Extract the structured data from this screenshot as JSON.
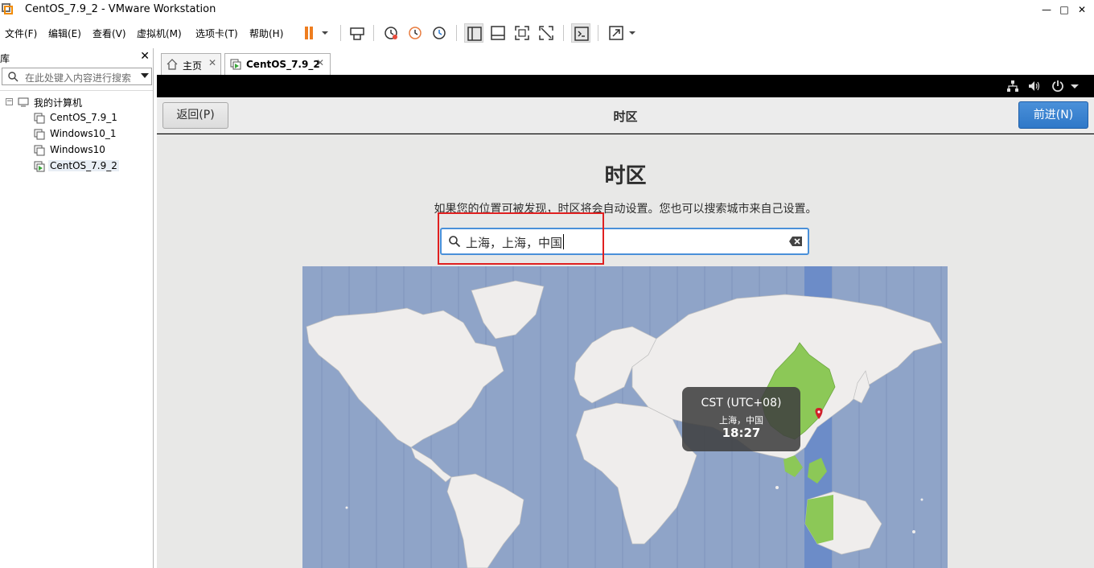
{
  "window": {
    "title": "CentOS_7.9_2 - VMware Workstation",
    "minimize": "—",
    "maximize": "□",
    "close": "✕"
  },
  "menu": [
    "文件(F)",
    "编辑(E)",
    "查看(V)",
    "虚拟机(M)",
    "选项卡(T)",
    "帮助(H)"
  ],
  "toolbar_icons": [
    "pause-icon",
    "send-ctrl-alt-del-icon",
    "snapshot-take-icon",
    "snapshot-revert-icon",
    "snapshot-manager-icon",
    "show-library-icon",
    "show-thumbnail-icon",
    "fullscreen-icon",
    "unity-icon",
    "console-view-icon",
    "stretch-icon"
  ],
  "library": {
    "title": "库",
    "close": "✕",
    "search_placeholder": "在此处键入内容进行搜索",
    "root": "我的计算机",
    "items": [
      "CentOS_7.9_1",
      "Windows10_1",
      "Windows10",
      "CentOS_7.9_2"
    ],
    "selected": "CentOS_7.9_2"
  },
  "tabs": [
    {
      "label": "主页",
      "close": "✕"
    },
    {
      "label": "CentOS_7.9_2",
      "close": "✕"
    }
  ],
  "installer": {
    "back_label": "返回(P)",
    "header_title": "时区",
    "next_label": "前进(N)",
    "page_title": "时区",
    "description": "如果您的位置可被发现，时区将会自动设置。您也可以搜索城市来自己设置。",
    "search_value": "上海，上海，中国",
    "tooltip": {
      "timezone": "CST (UTC+08)",
      "city": "上海，中国",
      "time": "18:27"
    }
  },
  "colors": {
    "accent": "#4a90d9",
    "map_ocean": "#8fa4c8",
    "map_land": "#efedec",
    "selected_zone": "#8cc857",
    "annotation_box": "#e02020"
  }
}
